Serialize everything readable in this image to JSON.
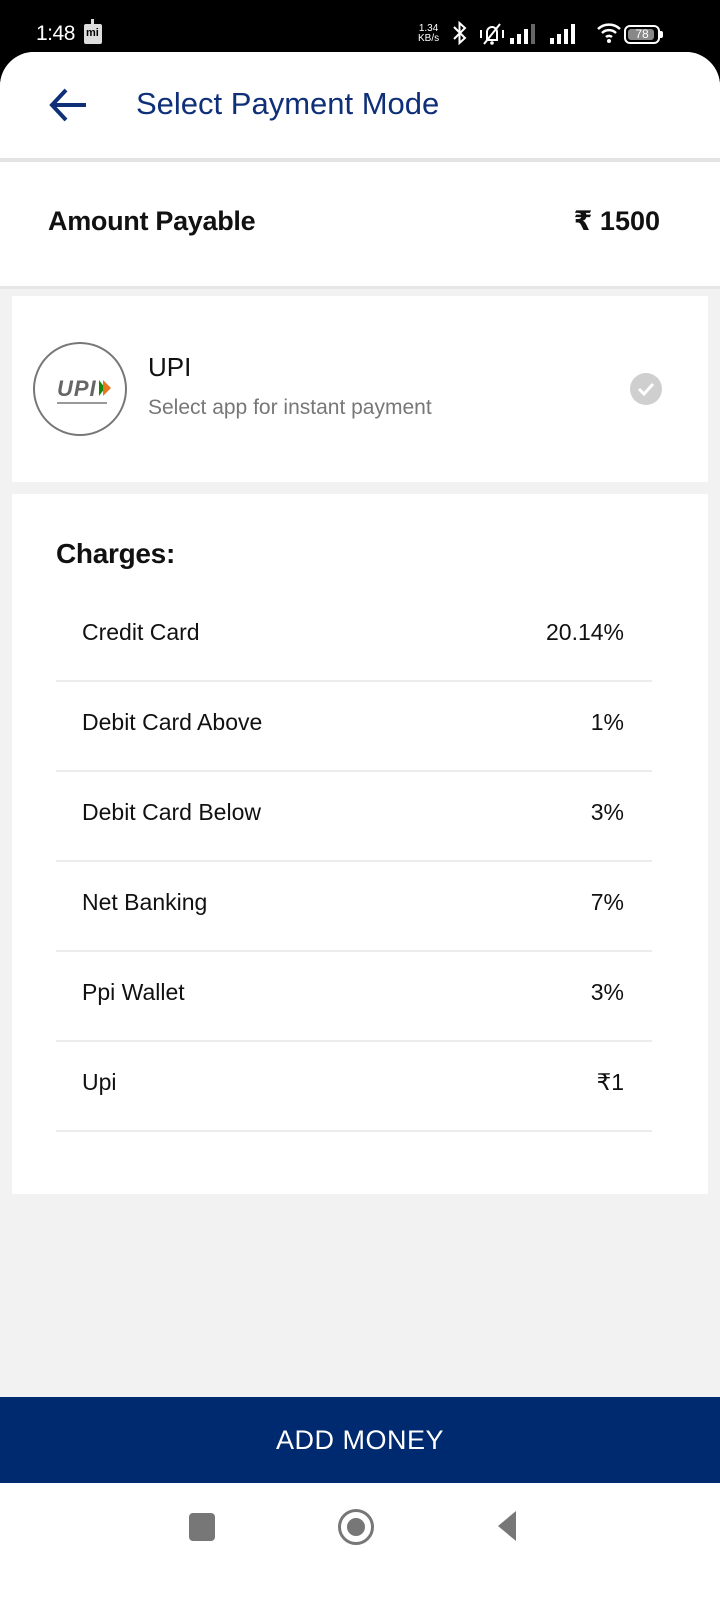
{
  "status_bar": {
    "time": "1:48",
    "net_speed_value": "1.34",
    "net_speed_unit": "KB/s",
    "battery_level": "78"
  },
  "header": {
    "title": "Select Payment Mode",
    "back_icon": "arrow-left-icon"
  },
  "amount": {
    "label": "Amount Payable",
    "value": "₹ 1500"
  },
  "payment_option": {
    "title": "UPI",
    "subtitle": "Select app for instant payment",
    "logo_text": "UPI",
    "selected_icon": "check-circle-icon"
  },
  "charges": {
    "title": "Charges:",
    "rows": [
      {
        "name": "Credit Card",
        "value": "20.14%"
      },
      {
        "name": "Debit Card Above",
        "value": "1%"
      },
      {
        "name": "Debit Card Below",
        "value": "3%"
      },
      {
        "name": "Net Banking",
        "value": "7%"
      },
      {
        "name": "Ppi Wallet",
        "value": "3%"
      },
      {
        "name": "Upi",
        "value": "₹1"
      }
    ]
  },
  "footer": {
    "button_label": "ADD MONEY"
  },
  "colors": {
    "brand_blue": "#002a6f",
    "title_blue": "#0f2f78"
  }
}
